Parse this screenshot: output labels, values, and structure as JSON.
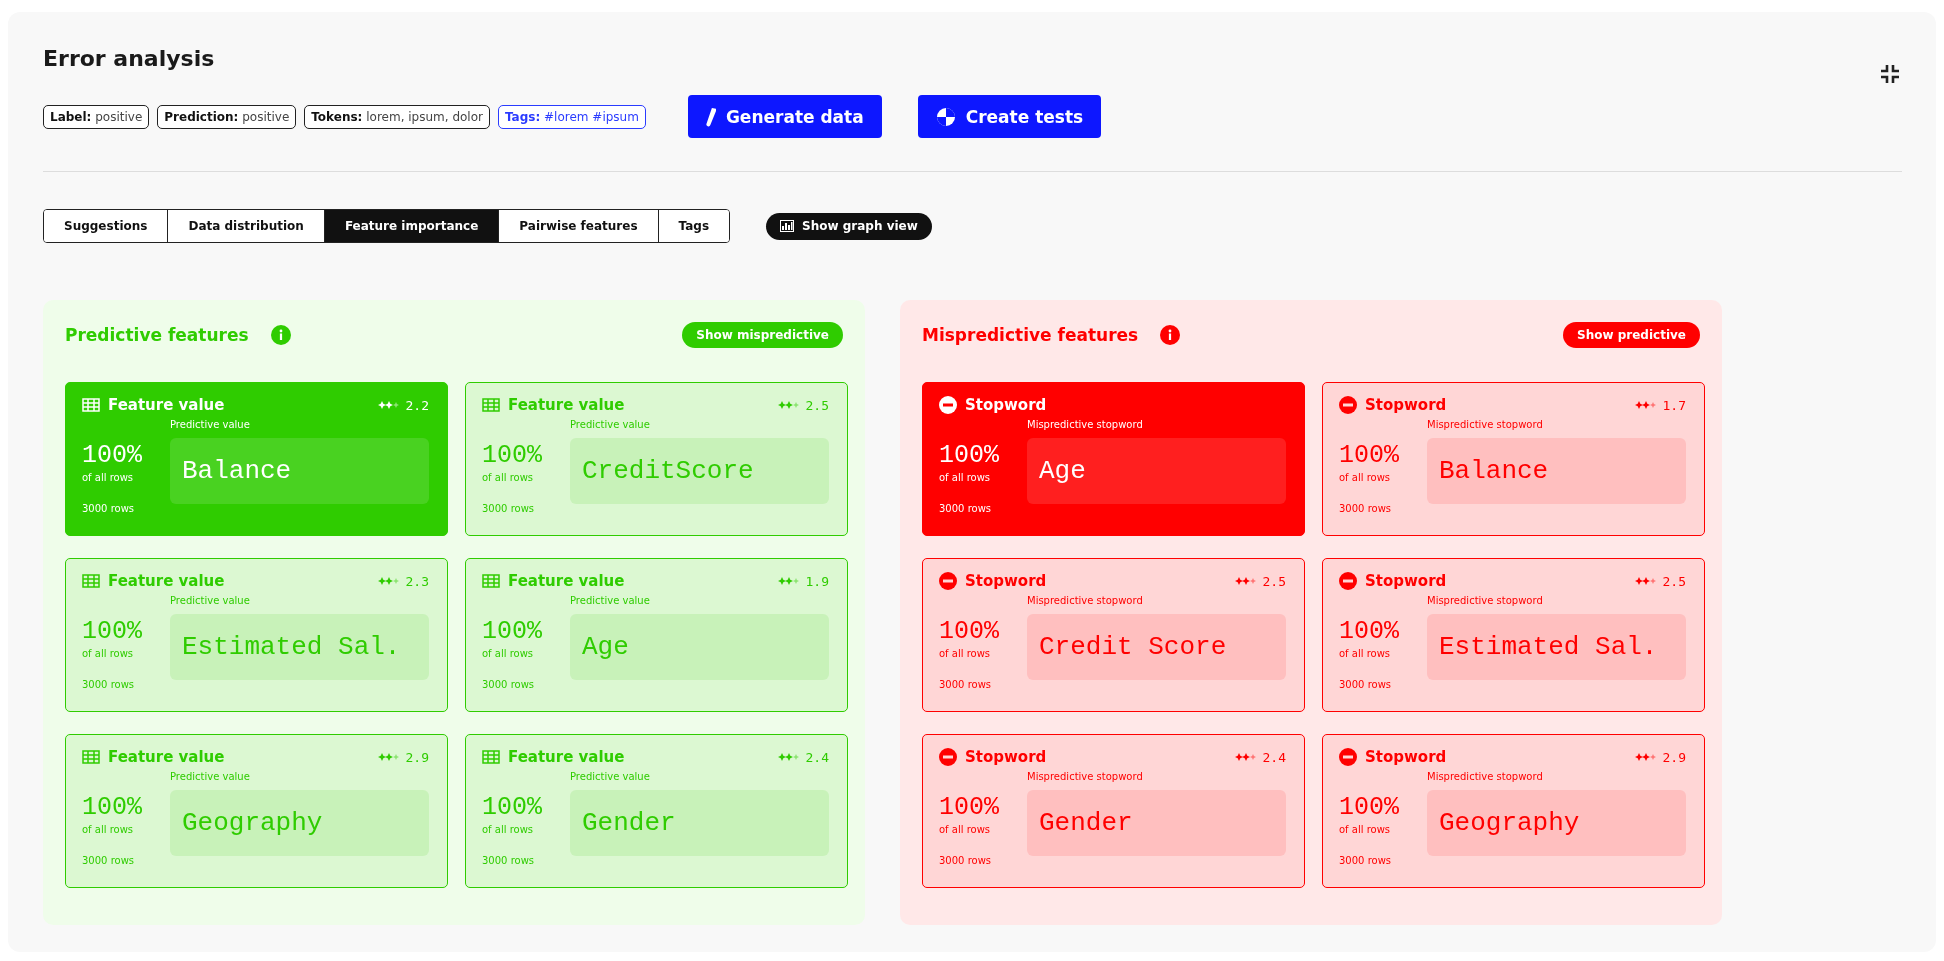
{
  "title": "Error analysis",
  "chips": [
    {
      "kind": "plain",
      "text": "**Label:** positive"
    },
    {
      "kind": "plain",
      "text": "**Prediction:** positive"
    },
    {
      "kind": "plain",
      "text": "**Tokens:** lorem, ipsum, dolor"
    },
    {
      "kind": "tag",
      "text": "**Tags:** #lorem #ipsum"
    }
  ],
  "actions": [
    {
      "kind": "generate",
      "label": "Generate data"
    },
    {
      "kind": "tests",
      "label": "Create tests"
    }
  ],
  "tabs": [
    {
      "label": "Suggestions",
      "selected": false
    },
    {
      "label": "Data distribution",
      "selected": false
    },
    {
      "label": "Feature importance",
      "selected": true
    },
    {
      "label": "Pairwise features",
      "selected": false
    },
    {
      "label": "Tags",
      "selected": false
    }
  ],
  "graph_toggle": "Show graph view",
  "panels": [
    {
      "kind": "predictive",
      "title": "Predictive features",
      "toggle": "Show mispredictive",
      "cards": [
        {
          "kind": "feature",
          "title": "Feature value",
          "score": "2.2",
          "percent": "100%",
          "percent_caption": "of all rows",
          "rows": "3000 rows",
          "value_label": "Predictive value",
          "value": "Balance",
          "selected": true
        },
        {
          "kind": "feature",
          "title": "Feature value",
          "score": "2.5",
          "percent": "100%",
          "percent_caption": "of all rows",
          "rows": "3000 rows",
          "value_label": "Predictive value",
          "value": "CreditScore",
          "selected": false
        },
        {
          "kind": "feature",
          "title": "Feature value",
          "score": "2.3",
          "percent": "100%",
          "percent_caption": "of all rows",
          "rows": "3000 rows",
          "value_label": "Predictive value",
          "value": "Estimated Sal.",
          "selected": false
        },
        {
          "kind": "feature",
          "title": "Feature value",
          "score": "1.9",
          "percent": "100%",
          "percent_caption": "of all rows",
          "rows": "3000 rows",
          "value_label": "Predictive value",
          "value": "Age",
          "selected": false
        },
        {
          "kind": "feature",
          "title": "Feature value",
          "score": "2.9",
          "percent": "100%",
          "percent_caption": "of all rows",
          "rows": "3000 rows",
          "value_label": "Predictive value",
          "value": "Geography",
          "selected": false
        },
        {
          "kind": "feature",
          "title": "Feature value",
          "score": "2.4",
          "percent": "100%",
          "percent_caption": "of all rows",
          "rows": "3000 rows",
          "value_label": "Predictive value",
          "value": "Gender",
          "selected": false
        }
      ]
    },
    {
      "kind": "mispredictive",
      "title": "Mispredictive features",
      "toggle": "Show predictive",
      "cards": [
        {
          "kind": "stopword",
          "title": "Stopword",
          "percent": "100%",
          "percent_caption": "of all rows",
          "rows": "3000 rows",
          "value_label": "Mispredictive stopword",
          "value": "Age",
          "selected": true
        },
        {
          "kind": "stopword",
          "title": "Stopword",
          "score": "1.7",
          "percent": "100%",
          "percent_caption": "of all rows",
          "rows": "3000 rows",
          "value_label": "Mispredictive stopword",
          "value": "Balance",
          "selected": false
        },
        {
          "kind": "stopword",
          "title": "Stopword",
          "score": "2.5",
          "percent": "100%",
          "percent_caption": "of all rows",
          "rows": "3000 rows",
          "value_label": "Mispredictive stopword",
          "value": "Credit Score",
          "selected": false
        },
        {
          "kind": "stopword",
          "title": "Stopword",
          "score": "2.5",
          "percent": "100%",
          "percent_caption": "of all rows",
          "rows": "3000 rows",
          "value_label": "Mispredictive stopword",
          "value": "Estimated Sal.",
          "selected": false
        },
        {
          "kind": "stopword",
          "title": "Stopword",
          "score": "2.4",
          "percent": "100%",
          "percent_caption": "of all rows",
          "rows": "3000 rows",
          "value_label": "Mispredictive stopword",
          "value": "Gender",
          "selected": false
        },
        {
          "kind": "stopword",
          "title": "Stopword",
          "score": "2.9",
          "percent": "100%",
          "percent_caption": "of all rows",
          "rows": "3000 rows",
          "value_label": "Mispredictive stopword",
          "value": "Geography",
          "selected": false
        }
      ]
    }
  ]
}
